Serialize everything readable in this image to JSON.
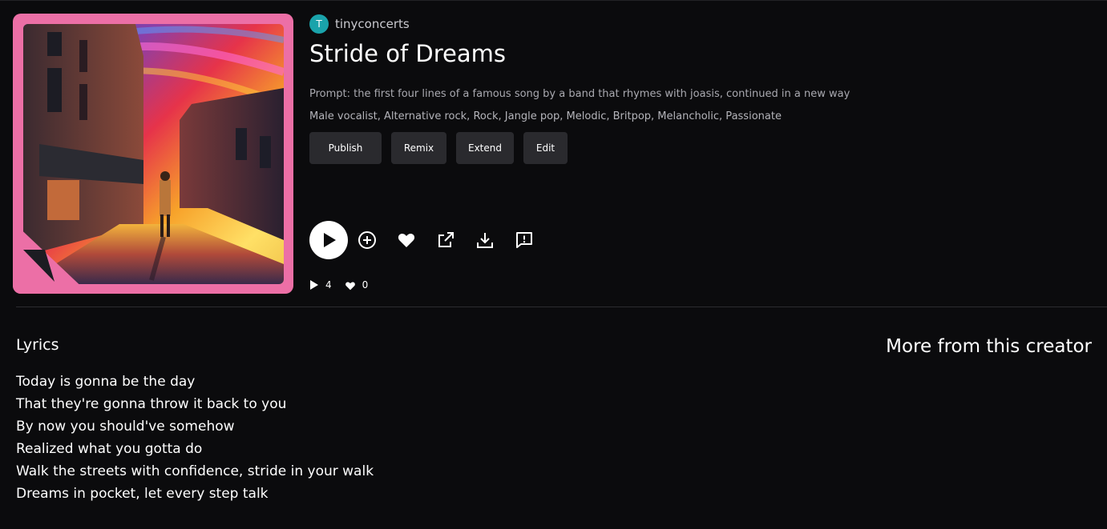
{
  "creator": {
    "initial": "T",
    "name": "tinyconcerts"
  },
  "song": {
    "title": "Stride of Dreams",
    "prompt": "Prompt: the first four lines of a famous song by a band that rhymes with joasis, continued in a new way",
    "tags": "Male vocalist, Alternative rock, Rock, Jangle pop, Melodic, Britpop, Melancholic, Passionate"
  },
  "actions": {
    "publish": "Publish",
    "remix": "Remix",
    "extend": "Extend",
    "edit": "Edit"
  },
  "stats": {
    "plays": "4",
    "likes": "0"
  },
  "lyrics": {
    "heading": "Lyrics",
    "lines": [
      "Today is gonna be the day",
      "That they're gonna throw it back to you",
      "By now you should've somehow",
      "Realized what you gotta do",
      "Walk the streets with confidence, stride in your walk",
      "Dreams in pocket, let every step talk"
    ]
  },
  "more_from_creator": {
    "heading": "More from this creator"
  },
  "colors": {
    "background": "#0b0b0d",
    "cover_frame": "#ec6fa6",
    "avatar": "#1aa3ab",
    "button_bg": "#2a2a2e"
  },
  "icons": {
    "play": "play-icon",
    "add": "plus-circle-icon",
    "like": "heart-icon",
    "share": "external-link-icon",
    "download": "download-icon",
    "report": "comment-alert-icon"
  }
}
